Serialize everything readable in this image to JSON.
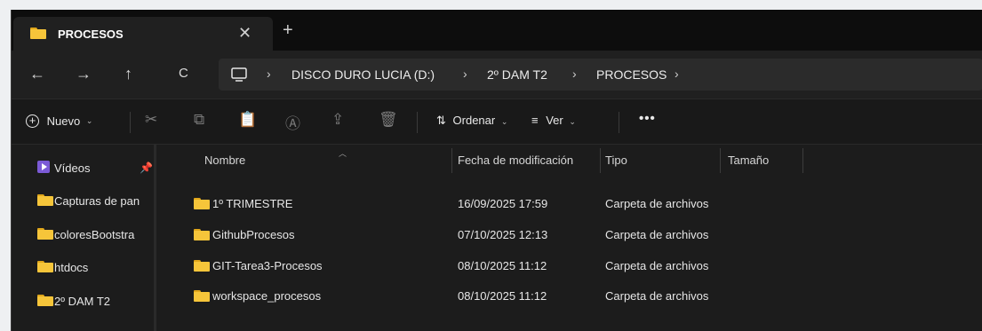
{
  "tab": {
    "title": "PROCESOS",
    "close": "✕",
    "new_tab": "+"
  },
  "nav": {
    "back": "←",
    "forward": "→",
    "up": "↑",
    "refresh": "C",
    "breadcrumb": [
      "DISCO DURO LUCIA (D:)",
      "2º DAM T2",
      "PROCESOS"
    ]
  },
  "toolbar": {
    "new_label": "Nuevo",
    "sort_label": "Ordenar",
    "view_label": "Ver",
    "more": "•••"
  },
  "sidebar": {
    "items": [
      {
        "label": "Vídeos",
        "icon": "video-icon",
        "pinned": true
      },
      {
        "label": "Capturas de pan",
        "icon": "folder-icon"
      },
      {
        "label": "coloresBootstra",
        "icon": "folder-icon"
      },
      {
        "label": "htdocs",
        "icon": "folder-icon"
      },
      {
        "label": "2º DAM T2",
        "icon": "folder-icon"
      }
    ]
  },
  "columns": {
    "name": "Nombre",
    "modified": "Fecha de modificación",
    "type": "Tipo",
    "size": "Tamaño"
  },
  "files": [
    {
      "name": "1º TRIMESTRE",
      "modified": "16/09/2025 17:59",
      "type": "Carpeta de archivos",
      "size": ""
    },
    {
      "name": "GithubProcesos",
      "modified": "07/10/2025 12:13",
      "type": "Carpeta de archivos",
      "size": ""
    },
    {
      "name": "GIT-Tarea3-Procesos",
      "modified": "08/10/2025 11:12",
      "type": "Carpeta de archivos",
      "size": ""
    },
    {
      "name": "workspace_procesos",
      "modified": "08/10/2025 11:12",
      "type": "Carpeta de archivos",
      "size": ""
    }
  ],
  "colors": {
    "folder": "#f6c53a",
    "background": "#1c1c1c",
    "tabbar": "#0d0d0d"
  }
}
